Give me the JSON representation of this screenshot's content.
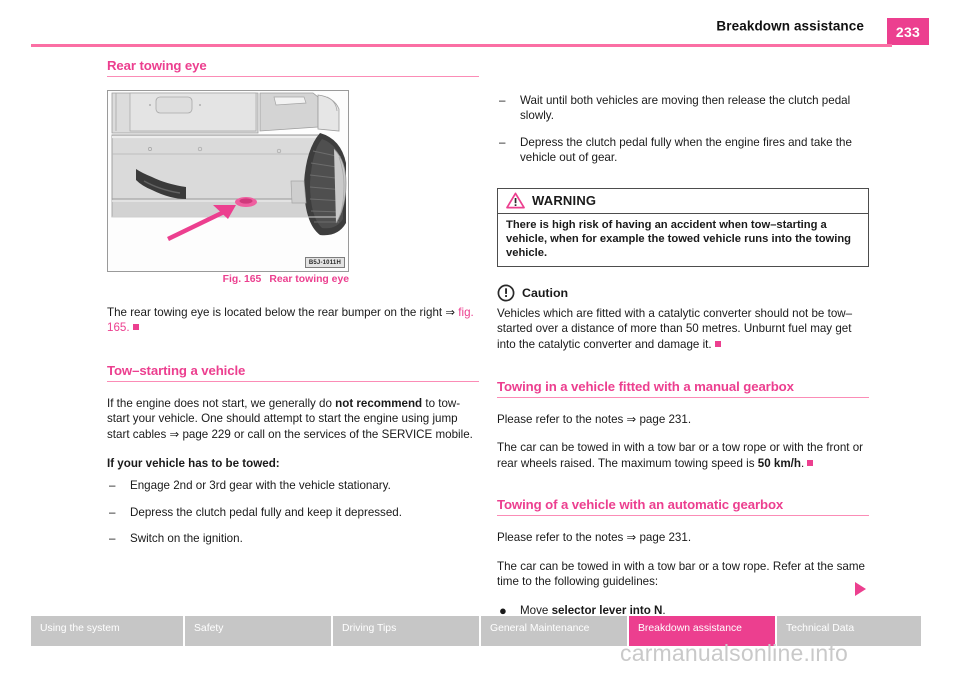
{
  "header": {
    "title": "Breakdown assistance",
    "page_number": "233",
    "accent_color": "#ec3f8f",
    "rule_color": "#fb6fa4"
  },
  "left_column": {
    "heading_1": "Rear towing eye",
    "figure": {
      "tag": "B5J-1011H",
      "caption_number": "Fig. 165",
      "caption_text": "Rear towing eye",
      "alt_name": "rear-bumper-towing-eye-illustration"
    },
    "paragraph_1_pre": "The rear towing eye is located below the rear bumper on the right ",
    "paragraph_1_ref": "fig. 165.",
    "heading_2": "Tow–starting a vehicle",
    "paragraph_2_a": "If the engine does not start, we generally do ",
    "paragraph_2_b": "not recommend",
    "paragraph_2_c": " to tow-start your vehicle. One should attempt to start the engine using jump start cables ⇒ page 229 or call on the services of the SERVICE mobile.",
    "subheading_1": "If your vehicle has to be towed:",
    "list_1": [
      {
        "marker": "–",
        "text": "Engage 2nd or 3rd gear with the vehicle stationary."
      },
      {
        "marker": "–",
        "text": "Depress the clutch pedal fully and keep it depressed."
      },
      {
        "marker": "–",
        "text": "Switch on the ignition."
      }
    ]
  },
  "right_column": {
    "list_1": [
      {
        "marker": "–",
        "text": "Wait until both vehicles are moving then release the clutch pedal slowly."
      },
      {
        "marker": "–",
        "text": "Depress the clutch pedal fully when the engine fires and take the vehicle out of gear."
      }
    ],
    "warning": {
      "icon": "warning-triangle-icon",
      "title": "WARNING",
      "body": "There is high risk of having an accident when tow–starting a vehicle, when for example the towed vehicle runs into the towing vehicle."
    },
    "caution": {
      "icon": "caution-circle-icon",
      "title": "Caution",
      "body": "Vehicles which are fitted with a catalytic converter should not be tow–started over a distance of more than 50 metres. Unburnt fuel may get into the catalytic converter and damage it."
    },
    "heading_manual": "Towing in a vehicle fitted with a manual gearbox",
    "manual_p1": "Please refer to the notes ⇒ page 231.",
    "manual_p2_a": "The car can be towed in with a tow bar or a tow rope or with the front or rear wheels raised. The maximum towing speed is ",
    "manual_p2_b": "50 km/h",
    "manual_p2_c": ".",
    "heading_automatic": "Towing of a vehicle with an automatic gearbox",
    "auto_p1": "Please refer to the notes ⇒ page 231.",
    "auto_p2": "The car can be towed in with a tow bar or a tow rope. Refer at the same time to the following guidelines:",
    "auto_list": [
      {
        "marker": "●",
        "text_pre": "Move ",
        "text_bold": "selector lever into N",
        "text_post": "."
      }
    ],
    "continuation_marker": "continuation-triangle-icon"
  },
  "footer": {
    "tabs": [
      {
        "label": "Using the system",
        "active": false
      },
      {
        "label": "Safety",
        "active": false
      },
      {
        "label": "Driving Tips",
        "active": false
      },
      {
        "label": "General Maintenance",
        "active": false
      },
      {
        "label": "Breakdown assistance",
        "active": true
      },
      {
        "label": "Technical Data",
        "active": false
      }
    ],
    "active_color": "#ec3f8f",
    "inactive_color": "#c6c6c6"
  },
  "watermark": "carmanualsonline.info"
}
